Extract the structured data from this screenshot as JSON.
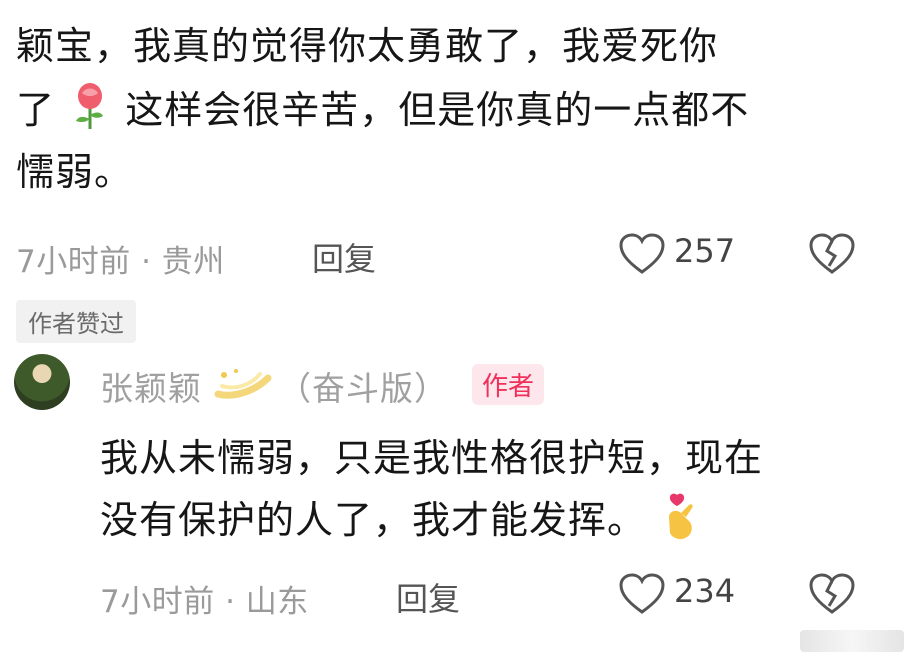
{
  "comment1": {
    "lines": [
      "颖宝，我真的觉得你太勇敢了，我爱死你",
      "了",
      "这样会很辛苦，但是你真的一点都不",
      "懦弱。"
    ],
    "emoji_icon": "rose-icon",
    "time_location": "7小时前 · 贵州",
    "reply_label": "回复",
    "like_count": "257",
    "liked_by_author_badge": "作者赞过"
  },
  "reply1": {
    "author_name": "张颖颖",
    "author_suffix": "（奋斗版）",
    "author_tag": "作者",
    "lines": [
      "我从未懦弱，只是我性格很护短，现在",
      "没有保护的人了，我才能发挥。"
    ],
    "emoji_icon": "heart-hands-icon",
    "time_location": "7小时前 · 山东",
    "reply_label": "回复",
    "like_count": "234"
  },
  "colors": {
    "text": "#161616",
    "meta": "#9a9a9a",
    "author_tag_bg": "#fde6ec",
    "author_tag_text": "#f0305a"
  }
}
